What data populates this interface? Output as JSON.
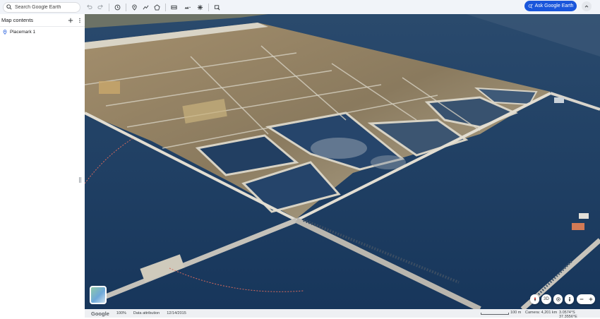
{
  "search": {
    "placeholder": "Search Google Earth"
  },
  "toolbar": {
    "tools": [
      "undo-icon",
      "redo-icon",
      "history-icon",
      "placemark-icon",
      "path-icon",
      "polygon-icon",
      "layers-icon",
      "image-overlay-icon",
      "weather-icon",
      "capture-icon"
    ],
    "ask_label": "Ask Google Earth"
  },
  "sidebar": {
    "title": "Map contents",
    "items": [
      {
        "label": "Placemark 1"
      }
    ]
  },
  "map": {
    "controls": {
      "view_3d": "3D"
    }
  },
  "statusbar": {
    "logo": "Google",
    "zoom": "100%",
    "attribution": "Data attribution",
    "date": "12/14/2015",
    "scale": "100 m",
    "camera": "Camera: 4,201 km",
    "coords": "3.0574°S 37.3556°E"
  },
  "colors": {
    "accent": "#1a56db",
    "water": "#1d3d63",
    "land": "#8a7d63"
  }
}
